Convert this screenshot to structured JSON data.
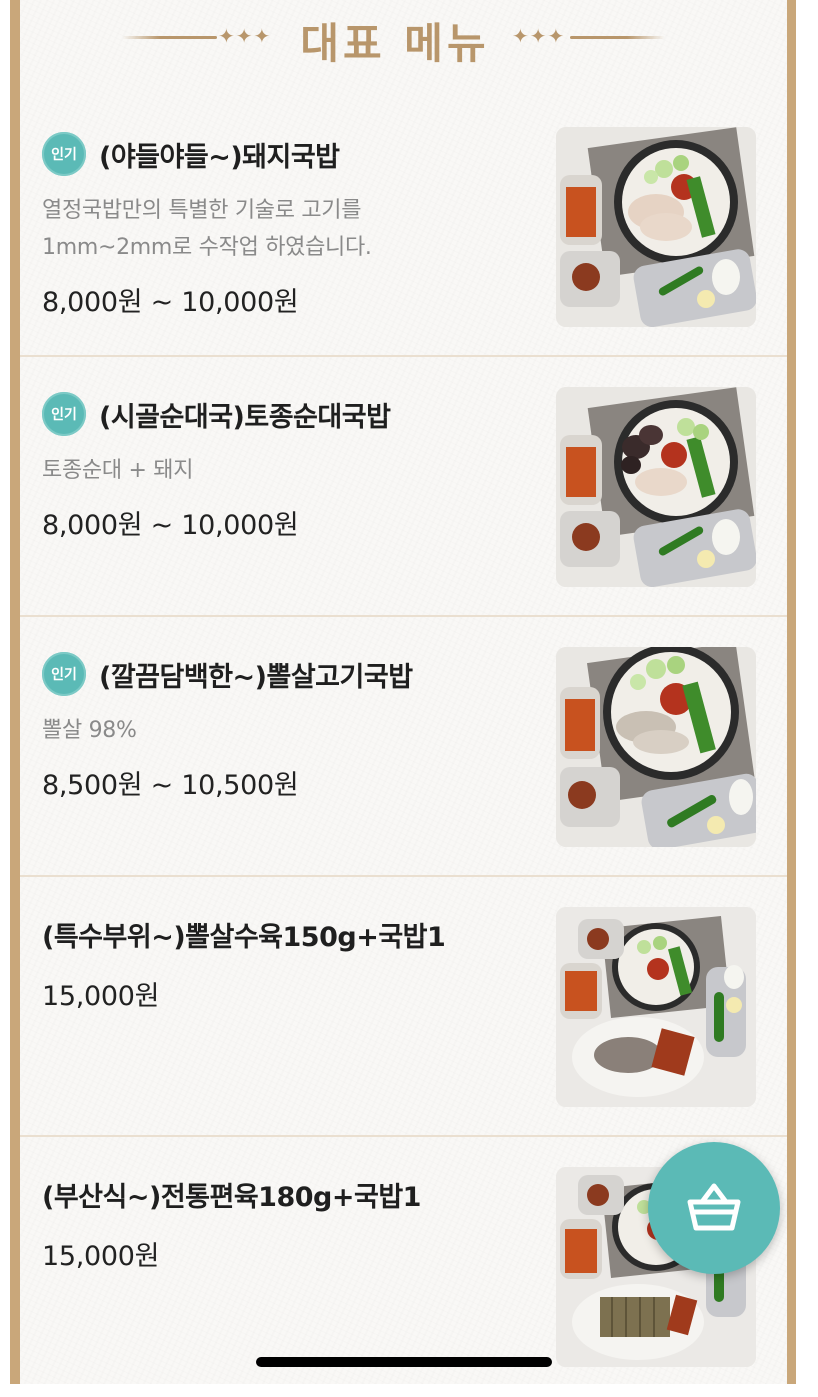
{
  "header": {
    "title": "대표 메뉴",
    "deco": "✦✦✦"
  },
  "menu": [
    {
      "badge": "인기",
      "name": "(야들야들~)돼지국밥",
      "desc_lines": [
        "열정국밥만의 특별한 기술로 고기를",
        "1mm~2mm로 수작업 하였습니다."
      ],
      "price": "8,000원 ~ 10,000원",
      "image": "pork-gukbap-photo"
    },
    {
      "badge": "인기",
      "name": "(시골순대국)토종순대국밥",
      "desc_lines": [
        "토종순대 + 돼지"
      ],
      "price": "8,000원 ~ 10,000원",
      "image": "sundae-gukbap-photo"
    },
    {
      "badge": "인기",
      "name": "(깔끔담백한~)뽈살고기국밥",
      "desc_lines": [
        "뽈살 98%"
      ],
      "price": "8,500원 ~ 10,500원",
      "image": "cheek-meat-gukbap-photo"
    },
    {
      "badge": "",
      "name": "(특수부위~)뽈살수육150g+국밥1",
      "desc_lines": [],
      "price": "15,000원",
      "image": "boiled-cheek-meat-set-photo"
    },
    {
      "badge": "",
      "name": "(부산식~)전통편육180g+국밥1",
      "desc_lines": [],
      "price": "15,000원",
      "image": "pressed-pork-set-photo"
    }
  ],
  "cart": {
    "icon": "basket-icon"
  },
  "colors": {
    "accent": "#5bbab6",
    "gold": "#b8966b",
    "border": "#c9a77a"
  }
}
